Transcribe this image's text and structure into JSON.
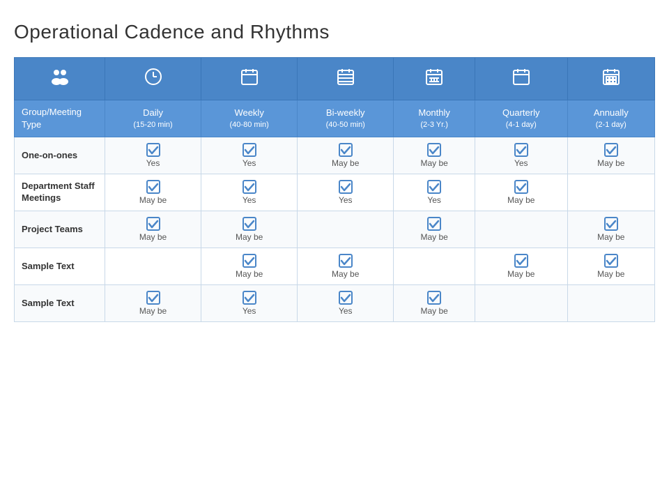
{
  "page": {
    "title": "Operational Cadence and Rhythms"
  },
  "table": {
    "icon_row": [
      {
        "icon": "👥",
        "label": "group-icon"
      },
      {
        "icon": "🕐",
        "label": "clock-icon"
      },
      {
        "icon": "📅",
        "label": "calendar-weekly-icon"
      },
      {
        "icon": "📆",
        "label": "calendar-biweekly-icon"
      },
      {
        "icon": "🗓",
        "label": "calendar-monthly-icon"
      },
      {
        "icon": "📄",
        "label": "calendar-quarterly-icon"
      },
      {
        "icon": "📋",
        "label": "calendar-annually-icon"
      }
    ],
    "subheader_row": [
      {
        "label": "Group/Meeting Type"
      },
      {
        "label": "Daily",
        "sublabel": "(15-20 min)"
      },
      {
        "label": "Weekly",
        "sublabel": "(40-80 min)"
      },
      {
        "label": "Bi-weekly",
        "sublabel": "(40-50 min)"
      },
      {
        "label": "Monthly",
        "sublabel": "(2-3 Yr.)"
      },
      {
        "label": "Quarterly",
        "sublabel": "(4-1 day)"
      },
      {
        "label": "Annually",
        "sublabel": "(2-1 day)"
      }
    ],
    "rows": [
      {
        "label": "One-on-ones",
        "cells": [
          {
            "checked": true,
            "text": "Yes"
          },
          {
            "checked": true,
            "text": "Yes"
          },
          {
            "checked": true,
            "text": "May be"
          },
          {
            "checked": true,
            "text": "May be"
          },
          {
            "checked": true,
            "text": "Yes"
          },
          {
            "checked": true,
            "text": "May be"
          }
        ]
      },
      {
        "label": "Department Staff Meetings",
        "cells": [
          {
            "checked": true,
            "text": "May be"
          },
          {
            "checked": true,
            "text": "Yes"
          },
          {
            "checked": true,
            "text": "Yes"
          },
          {
            "checked": true,
            "text": "Yes"
          },
          {
            "checked": true,
            "text": "May be"
          },
          {
            "checked": false,
            "text": ""
          }
        ]
      },
      {
        "label": "Project Teams",
        "cells": [
          {
            "checked": true,
            "text": "May be"
          },
          {
            "checked": true,
            "text": "May be"
          },
          {
            "checked": false,
            "text": ""
          },
          {
            "checked": true,
            "text": "May be"
          },
          {
            "checked": false,
            "text": ""
          },
          {
            "checked": true,
            "text": "May be"
          }
        ]
      },
      {
        "label": "Sample Text",
        "cells": [
          {
            "checked": false,
            "text": ""
          },
          {
            "checked": true,
            "text": "May be"
          },
          {
            "checked": true,
            "text": "May be"
          },
          {
            "checked": false,
            "text": ""
          },
          {
            "checked": true,
            "text": "May be"
          },
          {
            "checked": true,
            "text": "May be"
          }
        ]
      },
      {
        "label": "Sample Text",
        "cells": [
          {
            "checked": true,
            "text": "May be"
          },
          {
            "checked": true,
            "text": "Yes"
          },
          {
            "checked": true,
            "text": "Yes"
          },
          {
            "checked": true,
            "text": "May be"
          },
          {
            "checked": false,
            "text": ""
          },
          {
            "checked": false,
            "text": ""
          }
        ]
      }
    ]
  }
}
